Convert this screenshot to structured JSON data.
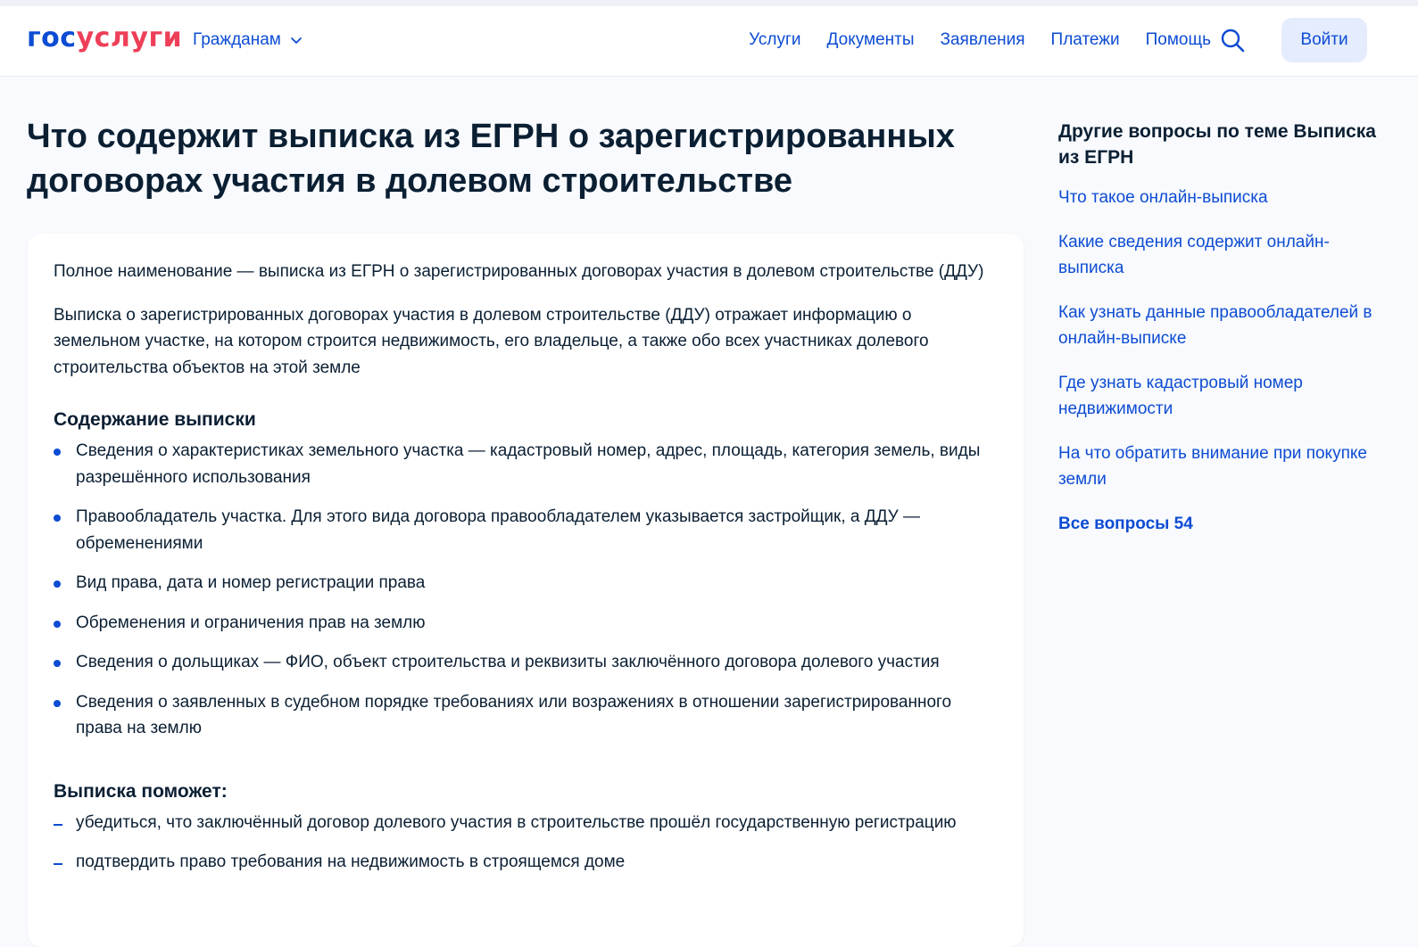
{
  "header": {
    "logo_part1": "гос",
    "logo_part2": "услуги",
    "audience": "Гражданам",
    "nav": [
      "Услуги",
      "Документы",
      "Заявления",
      "Платежи",
      "Помощь"
    ],
    "login_label": "Войти"
  },
  "icons": {
    "chevron": "chevron-down-icon",
    "search": "search-icon"
  },
  "colors": {
    "accent": "#0d4cd3",
    "logo_red": "#ee3f58",
    "text": "#0b1f33",
    "page_bg": "#f8fafd",
    "login_bg": "#e4ecfd"
  },
  "main": {
    "title": "Что содержит выписка из ЕГРН о зарегистрированных договорах участия в долевом строительстве",
    "paragraphs": [
      "Полное наименование — выписка из ЕГРН о зарегистрированных договорах участия в долевом строительстве (ДДУ)",
      "Выписка о зарегистрированных договорах участия в долевом строительстве (ДДУ) отражает информацию о земельном участке, на котором строится недвижимость, его владельце, а также обо всех участниках долевого строительства объектов на этой земле"
    ],
    "section1_title": "Содержание выписки",
    "section1_items": [
      "Сведения о характеристиках земельного участка — кадастровый номер, адрес, площадь, категория земель, виды разрешённого использования",
      "Правообладатель участка. Для этого вида договора правообладателем указывается застройщик, а ДДУ — обременениями",
      "Вид права, дата и номер регистрации права",
      "Обременения и ограничения прав на землю",
      "Сведения о дольщиках — ФИО, объект строительства и реквизиты заключённого договора долевого участия",
      "Сведения о заявленных в судебном порядке требованиях или возражениях в отношении зарегистрированного права на землю"
    ],
    "section2_title": "Выписка поможет:",
    "section2_items": [
      "убедиться, что заключённый договор долевого участия в строительстве прошёл государственную регистрацию",
      "подтвердить право требования на недвижимость в строящемся доме"
    ]
  },
  "sidebar": {
    "title": "Другие вопросы по теме Выписка из ЕГРН",
    "links": [
      "Что такое онлайн-выписка",
      "Какие сведения содержит онлайн-выписка",
      "Как узнать данные правообладателей в онлайн-выписке",
      "Где узнать кадастровый номер недвижимости",
      "На что обратить внимание при покупке земли"
    ],
    "all_questions": "Все вопросы 54"
  }
}
